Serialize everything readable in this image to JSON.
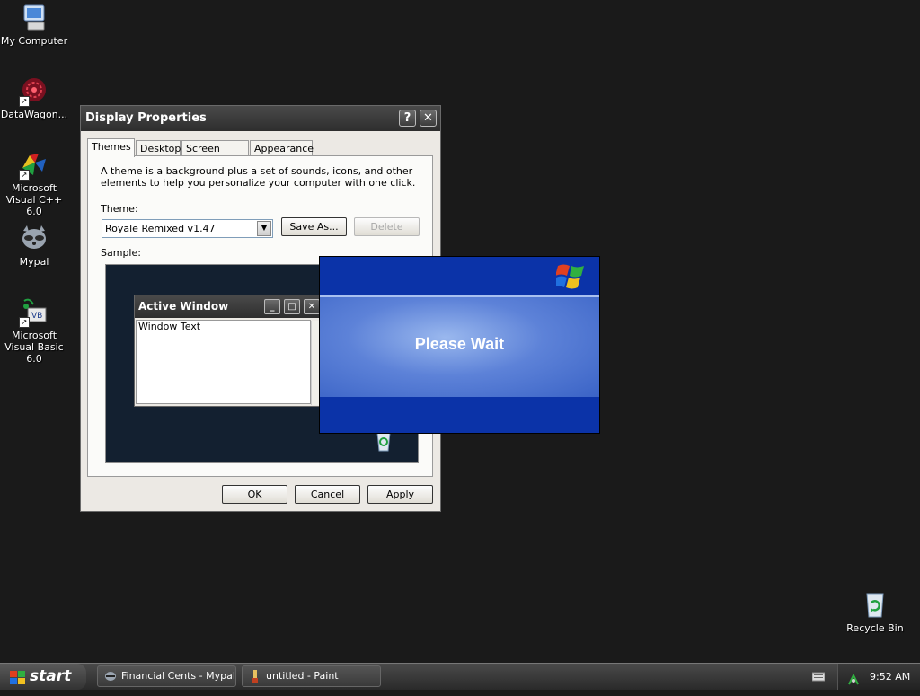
{
  "desktop": {
    "icons": [
      {
        "label": "My Computer"
      },
      {
        "label": "DataWagon..."
      },
      {
        "label": "Microsoft Visual C++ 6.0"
      },
      {
        "label": "Mypal"
      },
      {
        "label": "Microsoft Visual Basic 6.0"
      },
      {
        "label": "Recycle Bin"
      }
    ]
  },
  "dialog": {
    "title": "Display Properties",
    "help_btn": "?",
    "close_btn": "✕",
    "tabs": [
      {
        "label": "Themes"
      },
      {
        "label": "Desktop"
      },
      {
        "label": "Screen Saver"
      },
      {
        "label": "Appearance"
      }
    ],
    "description": "A theme is a background plus a set of sounds, icons, and other elements to help you personalize your computer with one click.",
    "theme_label": "Theme:",
    "theme_value": "Royale Remixed v1.47",
    "save_as": "Save As...",
    "delete": "Delete",
    "sample_label": "Sample:",
    "sample": {
      "window_title": "Active Window",
      "window_text": "Window Text"
    },
    "ok": "OK",
    "cancel": "Cancel",
    "apply": "Apply"
  },
  "splash": {
    "text": "Please Wait"
  },
  "taskbar": {
    "start": "start",
    "tasks": [
      {
        "label": "Financial Cents - Mypal"
      },
      {
        "label": "untitled - Paint"
      }
    ],
    "clock": "9:52 AM"
  }
}
